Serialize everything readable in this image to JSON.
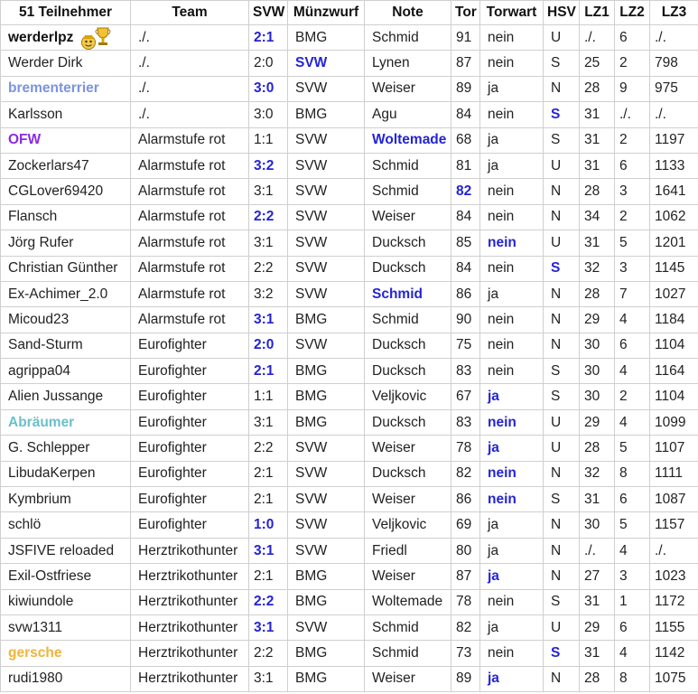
{
  "colors": {
    "highlight_blue": "#2424d6",
    "name_purple": "#8a2be2",
    "name_lightblue": "#7b93df",
    "name_teal": "#6cc0c8",
    "name_orange": "#f0b33c",
    "grid": "#cfcfcf"
  },
  "table": {
    "headers": [
      "51 Teilnehmer",
      "Team",
      "SVW",
      "Münzwurf",
      "Note",
      "Tor",
      "Torwart",
      "HSV",
      "LZ1",
      "LZ2",
      "LZ3"
    ],
    "rows": [
      {
        "cells": [
          "werderlpz",
          "./.",
          "2:1",
          "BMG",
          "Schmid",
          "91",
          "nein",
          "U",
          "./.",
          "6",
          "./."
        ],
        "name_style": "black",
        "trophy": true,
        "hl": [
          2
        ]
      },
      {
        "cells": [
          "Werder Dirk",
          "./.",
          "2:0",
          "SVW",
          "Lynen",
          "87",
          "nein",
          "S",
          "25",
          "2",
          "798"
        ],
        "hl": [
          3
        ]
      },
      {
        "cells": [
          "brementerrier",
          "./.",
          "3:0",
          "SVW",
          "Weiser",
          "89",
          "ja",
          "N",
          "28",
          "9",
          "975"
        ],
        "name_style": "lightblue",
        "hl": [
          2
        ]
      },
      {
        "cells": [
          "Karlsson",
          "./.",
          "3:0",
          "BMG",
          "Agu",
          "84",
          "nein",
          "S",
          "31",
          "./.",
          "./."
        ],
        "hl": [
          7
        ]
      },
      {
        "cells": [
          "OFW",
          "Alarmstufe rot",
          "1:1",
          "SVW",
          "Woltemade",
          "68",
          "ja",
          "S",
          "31",
          "2",
          "1197"
        ],
        "name_style": "purple",
        "hl": [
          4
        ]
      },
      {
        "cells": [
          "Zockerlars47",
          "Alarmstufe rot",
          "3:2",
          "SVW",
          "Schmid",
          "81",
          "ja",
          "U",
          "31",
          "6",
          "1133"
        ],
        "hl": [
          2
        ]
      },
      {
        "cells": [
          "CGLover69420",
          "Alarmstufe rot",
          "3:1",
          "SVW",
          "Schmid",
          "82",
          "nein",
          "N",
          "28",
          "3",
          "1641"
        ],
        "hl": [
          5
        ]
      },
      {
        "cells": [
          "Flansch",
          "Alarmstufe rot",
          "2:2",
          "SVW",
          "Weiser",
          "84",
          "nein",
          "N",
          "34",
          "2",
          "1062"
        ],
        "hl": [
          2
        ]
      },
      {
        "cells": [
          "Jörg Rufer",
          "Alarmstufe rot",
          "3:1",
          "SVW",
          "Ducksch",
          "85",
          "nein",
          "U",
          "31",
          "5",
          "1201"
        ],
        "hl": [
          6
        ]
      },
      {
        "cells": [
          "Christian Günther",
          "Alarmstufe rot",
          "2:2",
          "SVW",
          "Ducksch",
          "84",
          "nein",
          "S",
          "32",
          "3",
          "1145"
        ],
        "hl": [
          7
        ]
      },
      {
        "cells": [
          "Ex-Achimer_2.0",
          "Alarmstufe rot",
          "3:2",
          "SVW",
          "Schmid",
          "86",
          "ja",
          "N",
          "28",
          "7",
          "1027"
        ],
        "hl": [
          4
        ]
      },
      {
        "cells": [
          "Micoud23",
          "Alarmstufe rot",
          "3:1",
          "BMG",
          "Schmid",
          "90",
          "nein",
          "N",
          "29",
          "4",
          "1184"
        ],
        "hl": [
          2
        ]
      },
      {
        "cells": [
          "Sand-Sturm",
          "Eurofighter",
          "2:0",
          "SVW",
          "Ducksch",
          "75",
          "nein",
          "N",
          "30",
          "6",
          "1104"
        ],
        "hl": [
          2
        ]
      },
      {
        "cells": [
          "agrippa04",
          "Eurofighter",
          "2:1",
          "BMG",
          "Ducksch",
          "83",
          "nein",
          "S",
          "30",
          "4",
          "1164"
        ],
        "hl": [
          2
        ]
      },
      {
        "cells": [
          "Alien Jussange",
          "Eurofighter",
          "1:1",
          "BMG",
          "Veljkovic",
          "67",
          "ja",
          "S",
          "30",
          "2",
          "1104"
        ],
        "hl": [
          6
        ]
      },
      {
        "cells": [
          "Abräumer",
          "Eurofighter",
          "3:1",
          "BMG",
          "Ducksch",
          "83",
          "nein",
          "U",
          "29",
          "4",
          "1099"
        ],
        "name_style": "teal",
        "hl": [
          6
        ]
      },
      {
        "cells": [
          "G. Schlepper",
          "Eurofighter",
          "2:2",
          "SVW",
          "Weiser",
          "78",
          "ja",
          "U",
          "28",
          "5",
          "1107"
        ],
        "hl": [
          6
        ]
      },
      {
        "cells": [
          "LibudaKerpen",
          "Eurofighter",
          "2:1",
          "SVW",
          "Ducksch",
          "82",
          "nein",
          "N",
          "32",
          "8",
          "1111"
        ],
        "hl": [
          6
        ]
      },
      {
        "cells": [
          "Kymbrium",
          "Eurofighter",
          "2:1",
          "SVW",
          "Weiser",
          "86",
          "nein",
          "S",
          "31",
          "6",
          "1087"
        ],
        "hl": [
          6
        ]
      },
      {
        "cells": [
          "schlö",
          "Eurofighter",
          "1:0",
          "SVW",
          "Veljkovic",
          "69",
          "ja",
          "N",
          "30",
          "5",
          "1157"
        ],
        "hl": [
          2
        ]
      },
      {
        "cells": [
          "JSFIVE reloaded",
          "Herztrikothunter",
          "3:1",
          "SVW",
          "Friedl",
          "80",
          "ja",
          "N",
          "./.",
          "4",
          "./."
        ],
        "hl": [
          2
        ]
      },
      {
        "cells": [
          "Exil-Ostfriese",
          "Herztrikothunter",
          "2:1",
          "BMG",
          "Weiser",
          "87",
          "ja",
          "N",
          "27",
          "3",
          "1023"
        ],
        "hl": [
          6
        ]
      },
      {
        "cells": [
          "kiwiundole",
          "Herztrikothunter",
          "2:2",
          "BMG",
          "Woltemade",
          "78",
          "nein",
          "S",
          "31",
          "1",
          "1172"
        ],
        "hl": [
          2
        ]
      },
      {
        "cells": [
          "svw1311",
          "Herztrikothunter",
          "3:1",
          "SVW",
          "Schmid",
          "82",
          "ja",
          "U",
          "29",
          "6",
          "1155"
        ],
        "hl": [
          2
        ]
      },
      {
        "cells": [
          "gersche",
          "Herztrikothunter",
          "2:2",
          "BMG",
          "Schmid",
          "73",
          "nein",
          "S",
          "31",
          "4",
          "1142"
        ],
        "name_style": "orange",
        "hl": [
          7
        ]
      },
      {
        "cells": [
          "rudi1980",
          "Herztrikothunter",
          "3:1",
          "BMG",
          "Weiser",
          "89",
          "ja",
          "N",
          "28",
          "8",
          "1075"
        ],
        "hl": [
          6
        ]
      }
    ]
  }
}
